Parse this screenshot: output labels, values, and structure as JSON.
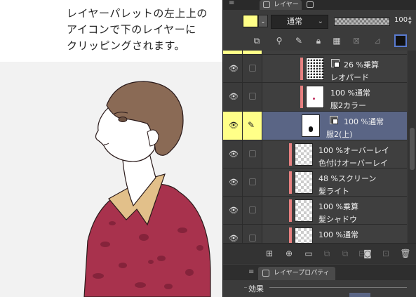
{
  "caption": {
    "lines": [
      "レイヤーパレットの左上上の",
      "アイコンで下のレイヤーに",
      "クリッピングされます。"
    ]
  },
  "panel": {
    "tabs": [
      {
        "label": "レイヤー",
        "icon": "layers-icon",
        "active": true
      },
      {
        "label": "",
        "icon": "layer-search-icon",
        "active": false
      }
    ],
    "swatch_color": "#ffff88",
    "blend_mode": "通常",
    "opacity": "100",
    "layers": [
      {
        "mode": "26 %乗算",
        "name": "レオパード",
        "thumb": "leopard",
        "clipped": true,
        "indent": 2,
        "selected": false
      },
      {
        "mode": "100 %通常",
        "name": "服2カラー",
        "thumb": "dot",
        "clipped": true,
        "indent": 2,
        "selected": false
      },
      {
        "mode": "100 %通常",
        "name": "服2(上)",
        "thumb": "dark",
        "clipped": false,
        "indent": 1,
        "selected": true
      },
      {
        "mode": "100 %オーバーレイ",
        "name": "色付けオーバーレイ",
        "thumb": "transparent",
        "clipped": true,
        "indent": 0,
        "selected": false
      },
      {
        "mode": "48 %スクリーン",
        "name": "髪ライト",
        "thumb": "transparent",
        "clipped": true,
        "indent": 0,
        "selected": false
      },
      {
        "mode": "100 %乗算",
        "name": "髪シャドウ",
        "thumb": "transparent",
        "clipped": true,
        "indent": 0,
        "selected": false
      },
      {
        "mode": "100 %通常",
        "name": "",
        "thumb": "transparent",
        "clipped": true,
        "indent": 0,
        "selected": false
      }
    ],
    "property_tab": "レイヤープロパティ",
    "effects_label": "効果",
    "accent_color": "#5a6585",
    "clip_color": "#e88080"
  }
}
